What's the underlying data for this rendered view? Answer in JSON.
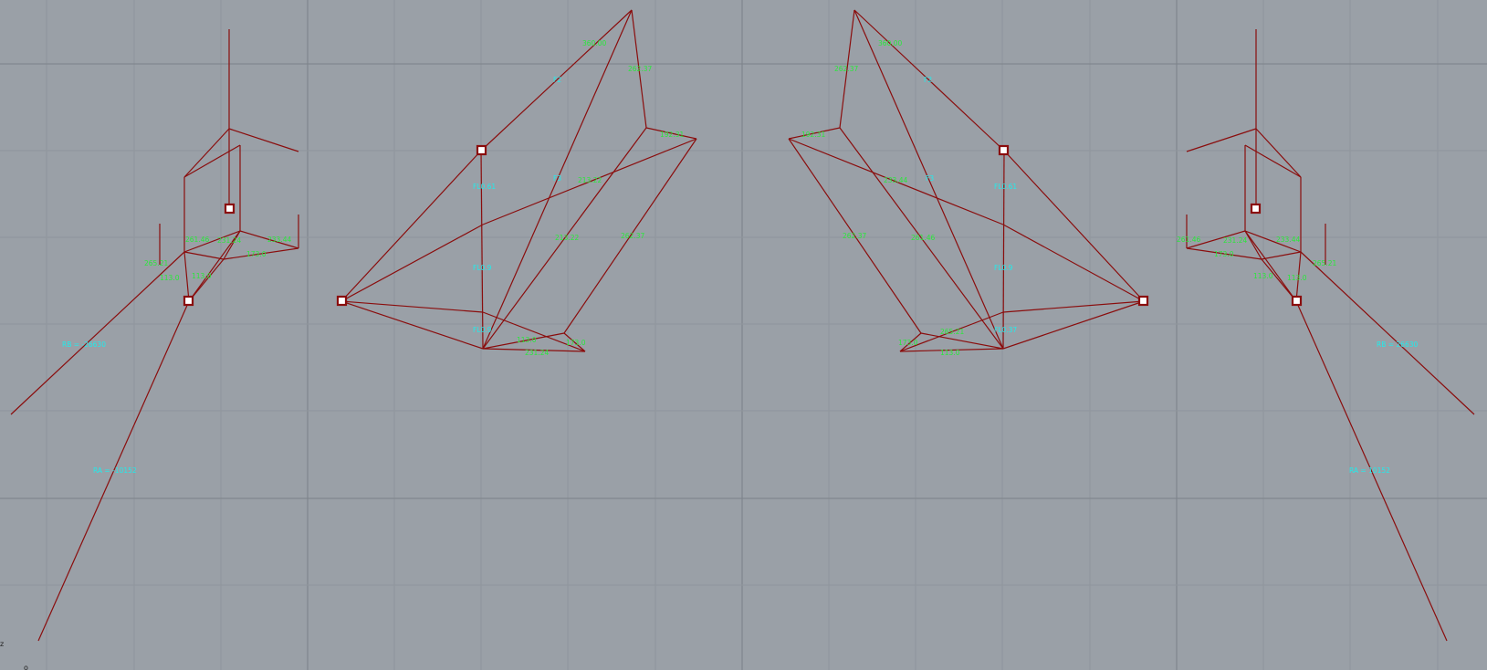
{
  "viewport": {
    "title": "",
    "background": "#9aa0a7",
    "grid_color": "#8f959c",
    "grid_major_color": "#7b8188",
    "member_color": "#8a0d0d",
    "support_label_color": "#20ecec",
    "member_label_color": "#29e83a"
  },
  "labels": {
    "left_support_RB": "RB = -26630",
    "left_support_RA": "RA = -10152",
    "right_support_RB": "RB = 26630",
    "right_support_RA": "RA = 10152",
    "mid_left_top": "FL0.61",
    "mid_left_mid": "FL0.9",
    "mid_left_low": "FL0.9",
    "mid_right_top": "FL0.61",
    "mid_right_mid": "FL0.9",
    "mid_right_low": "FL0.37",
    "panel2_a": "F2",
    "panel2_b": "F2",
    "panel3_a": "F3",
    "panel3_b": "F3",
    "member_1": "360.00",
    "member_2": "262.37",
    "member_3": "262.37",
    "member_4": "192.31",
    "member_5": "213.22",
    "member_6": "113.0",
    "member_7": "113.0",
    "member_8": "173.0",
    "member_9": "213.22",
    "member_10": "262.37",
    "member_11": "192.31",
    "member_12": "360.00",
    "member_13": "262.37",
    "member_14": "173.0",
    "member_15": "113.0",
    "cluster_1": "261.46",
    "cluster_2": "231.24",
    "cluster_3": "233.44",
    "cluster_4": "265.21",
    "cluster_5": "231.24",
    "cluster_6": "233.44",
    "cluster_7": "261.46",
    "cluster_8": "265.21",
    "axis_z": "z",
    "axis_o": "o"
  }
}
